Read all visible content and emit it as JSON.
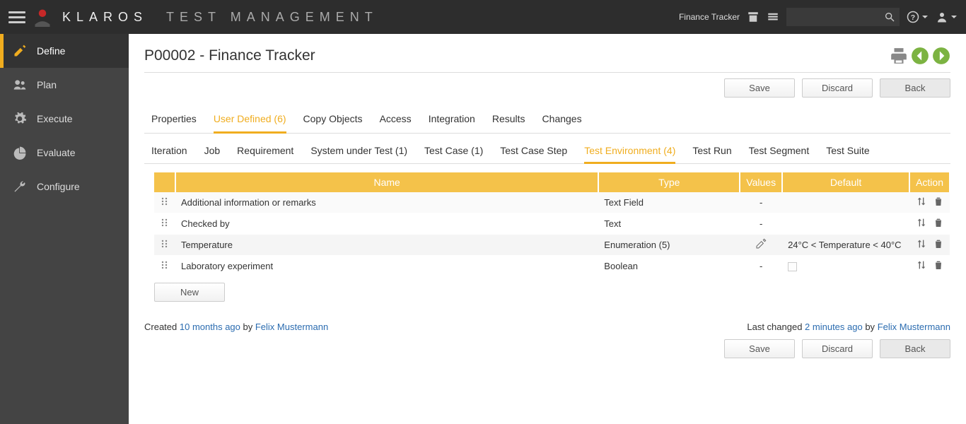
{
  "topbar": {
    "brand_bold": "KLAROS",
    "brand_light": "TEST MANAGEMENT",
    "project_label": "Finance Tracker",
    "search_placeholder": ""
  },
  "sidebar": {
    "items": [
      {
        "label": "Define"
      },
      {
        "label": "Plan"
      },
      {
        "label": "Execute"
      },
      {
        "label": "Evaluate"
      },
      {
        "label": "Configure"
      }
    ]
  },
  "page": {
    "title": "P00002 - Finance Tracker",
    "buttons": {
      "save": "Save",
      "discard": "Discard",
      "back": "Back",
      "new": "New"
    }
  },
  "tabs": [
    {
      "label": "Properties"
    },
    {
      "label": "User Defined (6)",
      "active": true
    },
    {
      "label": "Copy Objects"
    },
    {
      "label": "Access"
    },
    {
      "label": "Integration"
    },
    {
      "label": "Results"
    },
    {
      "label": "Changes"
    }
  ],
  "subtabs": [
    {
      "label": "Iteration"
    },
    {
      "label": "Job"
    },
    {
      "label": "Requirement"
    },
    {
      "label": "System under Test (1)"
    },
    {
      "label": "Test Case (1)"
    },
    {
      "label": "Test Case Step"
    },
    {
      "label": "Test Environment (4)",
      "active": true
    },
    {
      "label": "Test Run"
    },
    {
      "label": "Test Segment"
    },
    {
      "label": "Test Suite"
    }
  ],
  "table": {
    "headers": {
      "name": "Name",
      "type": "Type",
      "values": "Values",
      "default": "Default",
      "action": "Action"
    },
    "rows": [
      {
        "name": "Additional information or remarks",
        "type": "Text Field",
        "values": "-",
        "default": ""
      },
      {
        "name": "Checked by",
        "type": "Text",
        "values": "-",
        "default": ""
      },
      {
        "name": "Temperature",
        "type": "Enumeration (5)",
        "values": "",
        "default": "24°C < Temperature < 40°C",
        "editable": true
      },
      {
        "name": "Laboratory experiment",
        "type": "Boolean",
        "values": "-",
        "default": "",
        "checkbox": true
      }
    ]
  },
  "meta": {
    "created_prefix": "Created ",
    "created_time": "10 months ago",
    "created_by_prefix": " by ",
    "created_by": "Felix Mustermann",
    "changed_prefix": "Last changed ",
    "changed_time": "2 minutes ago",
    "changed_by_prefix": " by ",
    "changed_by": "Felix Mustermann"
  }
}
